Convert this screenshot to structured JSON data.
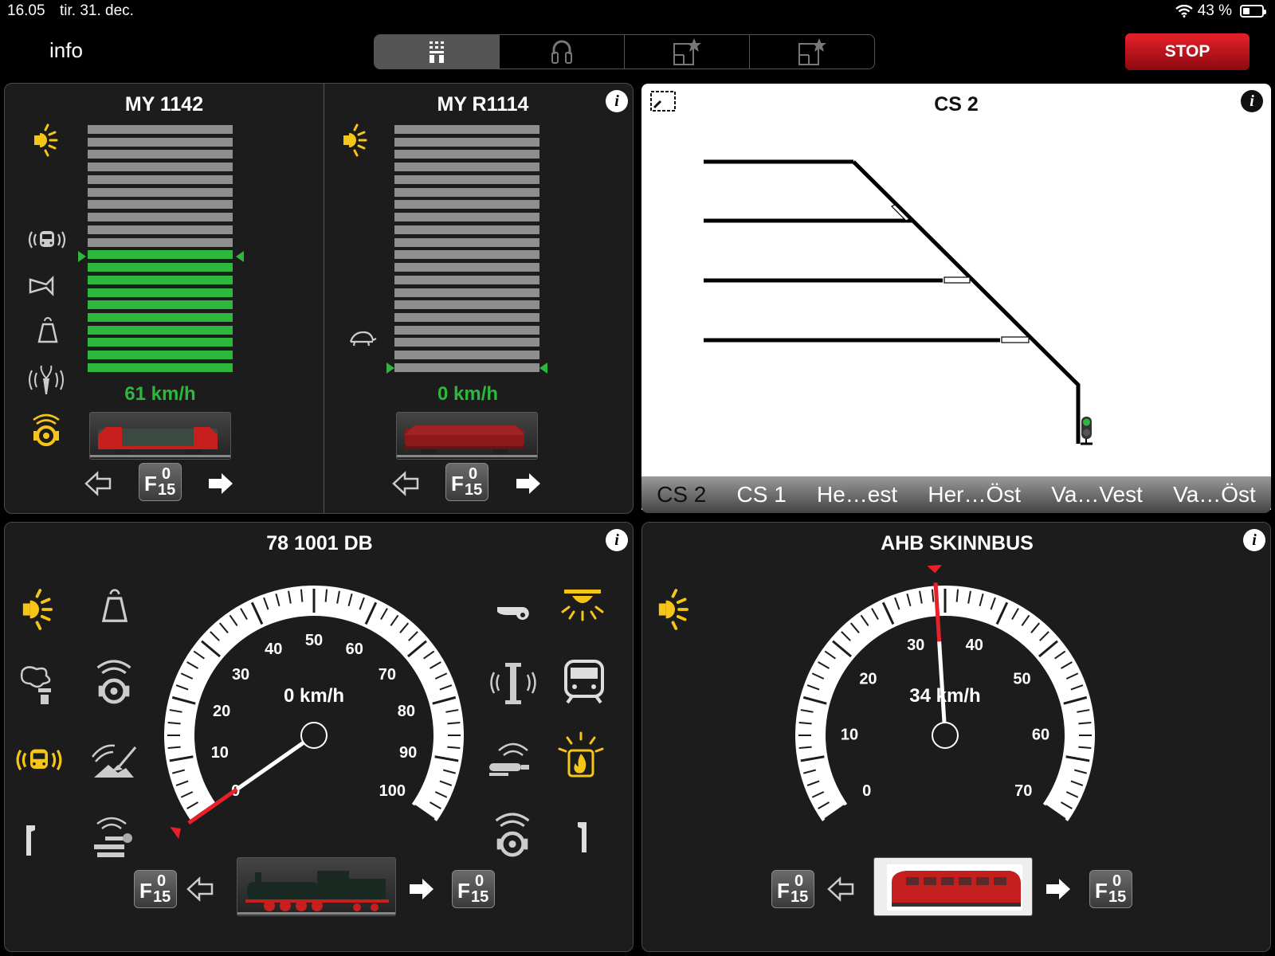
{
  "status": {
    "time": "16.05",
    "date": "tir. 31. dec.",
    "battery": "43 %"
  },
  "header": {
    "info_label": "info",
    "stop_label": "STOP",
    "segments": [
      "keyboard",
      "headset",
      "layout-star",
      "layout-star-2"
    ]
  },
  "panel1": {
    "left": {
      "title": "MY 1142",
      "speed": "61 km/h",
      "speed_level": 0.5,
      "loco_color": "#c81e1e"
    },
    "right": {
      "title": "MY R1114",
      "speed": "0 km/h",
      "speed_level": 0.0,
      "loco_color": "#8c1a1a"
    },
    "f_label": {
      "F": "F",
      "top": "0",
      "bottom": "15"
    }
  },
  "layout": {
    "title": "CS 2",
    "tabs": [
      "CS 2",
      "CS 1",
      "He…est",
      "Her…Öst",
      "Va…Vest",
      "Va…Öst"
    ],
    "active_tab": "CS 2"
  },
  "loco3": {
    "title": "78 1001 DB",
    "speed": "0 km/h",
    "gauge": {
      "min": 0,
      "max": 100,
      "value": 0,
      "ticks": [
        0,
        10,
        20,
        30,
        40,
        50,
        60,
        70,
        80,
        90,
        100
      ]
    }
  },
  "loco4": {
    "title": "AHB SKINNBUS",
    "speed": "34 km/h",
    "gauge": {
      "min": 0,
      "max": 70,
      "value": 34,
      "ticks": [
        0,
        10,
        20,
        30,
        40,
        50,
        60,
        70
      ]
    }
  },
  "colors": {
    "yellow": "#f5c518",
    "green": "#2db83d",
    "red": "#e8202a",
    "panel": "#1c1c1c"
  }
}
